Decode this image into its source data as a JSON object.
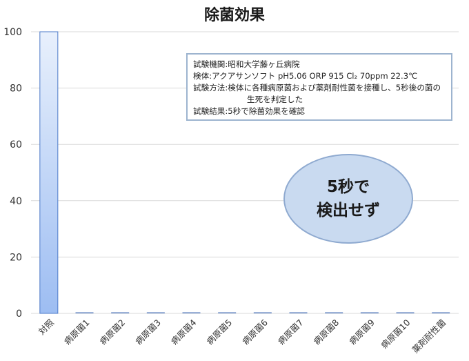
{
  "chart_data": {
    "type": "bar",
    "title": "除菌効果",
    "xlabel": "",
    "ylabel": "",
    "categories": [
      "対照",
      "病原菌1",
      "病原菌2",
      "病原菌3",
      "病原菌4",
      "病原菌5",
      "病原菌6",
      "病原菌7",
      "病原菌8",
      "病原菌9",
      "病原菌10",
      "薬剤耐性菌"
    ],
    "values": [
      100,
      0,
      0,
      0,
      0,
      0,
      0,
      0,
      0,
      0,
      0,
      0
    ],
    "ylim": [
      0,
      100
    ],
    "yticks": [
      0,
      20,
      40,
      60,
      80,
      100
    ],
    "grid": true,
    "colors": {
      "bar_top": "#e8f0fc",
      "bar_bottom": "#9dbdf2",
      "bar_edge": "#4a78c8",
      "zero_bar": "#5b7fbf"
    }
  },
  "info_box": {
    "lines": [
      "試験機関:昭和大学藤ヶ丘病院",
      "検体:アクアサンソフト pH5.06 ORP 915 Cl₂ 70ppm 22.3℃",
      "試験方法:検体に各種病原菌および薬剤耐性菌を接種し、5秒後の菌の",
      "生死を判定した",
      "試験結果:5秒で除菌効果を確認"
    ]
  },
  "callout": {
    "line1": "5秒で",
    "line2": "検出せず"
  }
}
